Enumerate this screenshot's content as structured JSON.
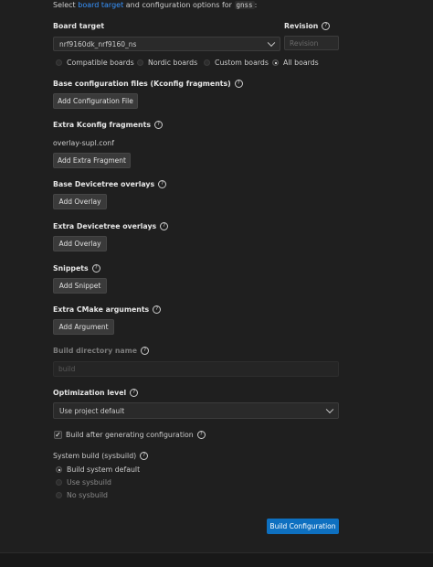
{
  "intro": {
    "prefix": "Select ",
    "link": "board target",
    "middle": " and configuration options for ",
    "app": "gnss",
    "suffix": ":"
  },
  "board": {
    "label": "Board target",
    "value": "nrf9160dk_nrf9160_ns",
    "revision_label": "Revision",
    "revision_placeholder": "Revision",
    "filters": [
      {
        "label": "Compatible boards",
        "selected": false
      },
      {
        "label": "Nordic boards",
        "selected": false
      },
      {
        "label": "Custom boards",
        "selected": false
      },
      {
        "label": "All boards",
        "selected": true
      }
    ]
  },
  "base_config": {
    "label": "Base configuration files (Kconfig fragments)",
    "button": "Add Configuration File"
  },
  "extra_kconfig": {
    "label": "Extra Kconfig fragments",
    "file": "overlay-supl.conf",
    "button": "Add Extra Fragment"
  },
  "base_dt": {
    "label": "Base Devicetree overlays",
    "button": "Add Overlay"
  },
  "extra_dt": {
    "label": "Extra Devicetree overlays",
    "button": "Add Overlay"
  },
  "snippets": {
    "label": "Snippets",
    "button": "Add Snippet"
  },
  "cmake": {
    "label": "Extra CMake arguments",
    "button": "Add Argument"
  },
  "build_dir": {
    "label": "Build directory name",
    "placeholder": "build"
  },
  "optimization": {
    "label": "Optimization level",
    "value": "Use project default"
  },
  "build_after": {
    "label": "Build after generating configuration",
    "checked": true
  },
  "sysbuild": {
    "label": "System build (sysbuild)",
    "options": [
      {
        "label": "Build system default",
        "selected": true
      },
      {
        "label": "Use sysbuild",
        "selected": false
      },
      {
        "label": "No sysbuild",
        "selected": false
      }
    ]
  },
  "build_button": "Build Configuration"
}
